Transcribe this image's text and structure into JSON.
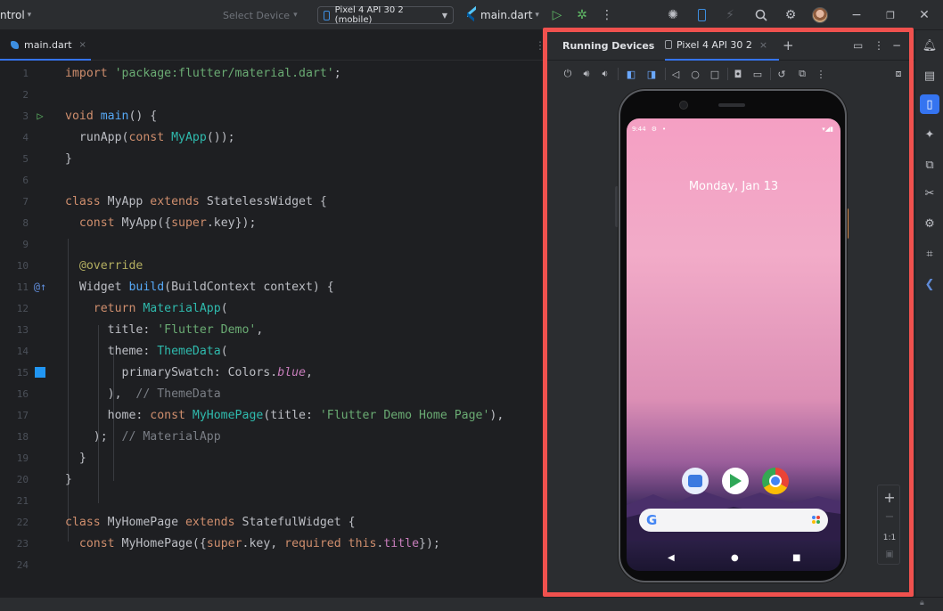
{
  "toolbar": {
    "project_label": "ntrol",
    "select_device": "Select Device",
    "device": "Pixel 4 API 30 2 (mobile)",
    "run_config": "main.dart",
    "accent": "#3574f0"
  },
  "editor": {
    "tab": {
      "label": "main.dart",
      "close": "×"
    },
    "more": "⋮",
    "lines": [
      {
        "n": "1"
      },
      {
        "n": "2"
      },
      {
        "n": "3"
      },
      {
        "n": "4"
      },
      {
        "n": "5"
      },
      {
        "n": "6"
      },
      {
        "n": "7"
      },
      {
        "n": "8"
      },
      {
        "n": "9"
      },
      {
        "n": "10"
      },
      {
        "n": "11"
      },
      {
        "n": "12"
      },
      {
        "n": "13"
      },
      {
        "n": "14"
      },
      {
        "n": "15"
      },
      {
        "n": "16"
      },
      {
        "n": "17"
      },
      {
        "n": "18"
      },
      {
        "n": "19"
      },
      {
        "n": "20"
      },
      {
        "n": "21"
      },
      {
        "n": "22"
      },
      {
        "n": "23"
      },
      {
        "n": "24"
      }
    ],
    "code": {
      "l1": [
        "import ",
        "'package:flutter/material.dart'",
        ";"
      ],
      "l3": [
        "void ",
        "main",
        "() {"
      ],
      "l4": [
        "  runApp(",
        "const ",
        "MyApp",
        "());"
      ],
      "l5": [
        "}"
      ],
      "l7": [
        "class ",
        "MyApp ",
        "extends ",
        "StatelessWidget {"
      ],
      "l8": [
        "  ",
        "const ",
        "MyApp({",
        "super",
        ".key});"
      ],
      "l10": [
        "  ",
        "@override"
      ],
      "l11": [
        "  Widget ",
        "build",
        "(BuildContext context) {"
      ],
      "l12": [
        "    ",
        "return ",
        "MaterialApp",
        "("
      ],
      "l13": [
        "      title: ",
        "'Flutter Demo'",
        ","
      ],
      "l14": [
        "      theme: ",
        "ThemeData",
        "("
      ],
      "l15": [
        "        primarySwatch: Colors.",
        "blue",
        ","
      ],
      "l16": [
        "      ),  ",
        "// ThemeData"
      ],
      "l17": [
        "      home: ",
        "const ",
        "MyHomePage",
        "(title: ",
        "'Flutter Demo Home Page'",
        "),"
      ],
      "l18": [
        "    );  ",
        "// MaterialApp"
      ],
      "l19": [
        "  }"
      ],
      "l20": [
        "}"
      ],
      "l22": [
        "class ",
        "MyHomePage ",
        "extends ",
        "StatefulWidget {"
      ],
      "l23": [
        "  ",
        "const ",
        "MyHomePage({",
        "super",
        ".key, ",
        "required ",
        "this",
        ".",
        "title",
        "});"
      ]
    },
    "swatch_color": "#2196f3"
  },
  "panel": {
    "title": "Running Devices",
    "tab": "Pixel 4 API 30 2",
    "tab_close": "×",
    "add": "+",
    "border_color": "#f0514e"
  },
  "phone": {
    "time": "9:44",
    "date": "Monday, Jan 13",
    "search_logo": "G"
  },
  "zoom": {
    "plus": "+",
    "minus": "−",
    "one_to_one": "1:1"
  }
}
